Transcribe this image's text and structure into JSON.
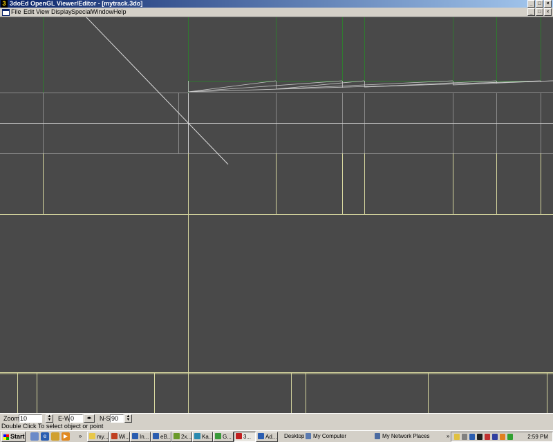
{
  "window": {
    "title": "3doEd OpenGL Viewer/Editor - [mytrack.3do]",
    "app_icon_glyph": "3",
    "buttons": {
      "minimize": "_",
      "maximize": "□",
      "close": "×"
    }
  },
  "menu": {
    "items": [
      "File",
      "Edit",
      "View",
      "Display",
      "Special",
      "Window",
      "Help"
    ]
  },
  "controls": {
    "zoom_label": "Zoom",
    "zoom_value": "10",
    "ew_label": "E-W",
    "ew_value": "0",
    "ns_label": "N-S",
    "ns_value": "90"
  },
  "status": {
    "text": "Double Click To select object or point"
  },
  "taskbar": {
    "start_label": "Start",
    "quick_launch_icons": [
      "desktop-icon",
      "ie-icon",
      "outlook-icon",
      "media-player-icon"
    ],
    "buttons": [
      {
        "label": "my...",
        "icon": "folder-icon",
        "color": "#e8c84a"
      },
      {
        "label": "Wi...",
        "icon": "app-icon",
        "color": "#c04020"
      },
      {
        "label": "In...",
        "icon": "ie-icon",
        "color": "#2a5db0"
      },
      {
        "label": "eB...",
        "icon": "ie-icon",
        "color": "#2a5db0"
      },
      {
        "label": "2x...",
        "icon": "app-icon",
        "color": "#6a9a2a"
      },
      {
        "label": "Ka...",
        "icon": "app-icon",
        "color": "#2a8ab0"
      },
      {
        "label": "G...",
        "icon": "app-icon",
        "color": "#3a9a3a"
      },
      {
        "label": "3...",
        "icon": "3doed-icon",
        "color": "#c02020"
      },
      {
        "label": "Ad...",
        "icon": "ie-icon",
        "color": "#2a5db0"
      }
    ],
    "desktop_label": "Desktop",
    "mycomputer_label": "My Computer",
    "network_label": "My Network Places",
    "chevron": "»",
    "clock": "2:59 PM"
  },
  "colors": {
    "viewport_bg": "#494949",
    "green_line": "#2f7a2f",
    "yellow_line": "#d8d8a0",
    "white_line": "#d0d0d0",
    "gray_line": "#8a8a8a",
    "title_start": "#0a246a",
    "title_end": "#a6caf0"
  }
}
